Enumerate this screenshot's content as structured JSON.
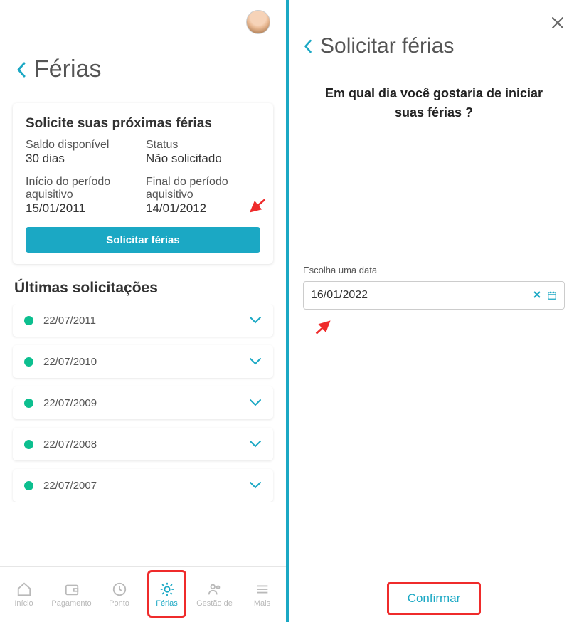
{
  "left": {
    "page_title": "Férias",
    "card": {
      "title": "Solicite suas próximas férias",
      "saldo_label": "Saldo disponível",
      "saldo_value": "30 dias",
      "status_label": "Status",
      "status_value": "Não solicitado",
      "inicio_label": "Início do período aquisitivo",
      "inicio_value": "15/01/2011",
      "final_label": "Final do período aquisitivo",
      "final_value": "14/01/2012",
      "button": "Solicitar férias"
    },
    "list_title": "Últimas solicitações",
    "requests": [
      "22/07/2011",
      "22/07/2010",
      "22/07/2009",
      "22/07/2008",
      "22/07/2007"
    ],
    "nav": {
      "inicio": "Início",
      "pagamento": "Pagamento",
      "ponto": "Ponto",
      "ferias": "Férias",
      "gestao": "Gestão de",
      "mais": "Mais"
    }
  },
  "right": {
    "title": "Solicitar férias",
    "question": "Em qual dia você gostaria de iniciar suas férias ?",
    "date_label": "Escolha uma data",
    "date_value": "16/01/2022",
    "confirm": "Confirmar"
  }
}
